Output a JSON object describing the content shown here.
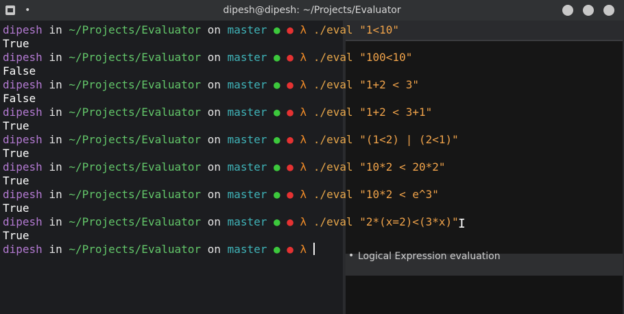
{
  "window": {
    "title": "dipesh@dipesh: ~/Projects/Evaluator",
    "menu_dot": "•"
  },
  "prompt": {
    "user": "dipesh",
    "in": "in",
    "path": "~/Projects/Evaluator",
    "on": "on",
    "branch": "master",
    "dot_green": "●",
    "dot_red": "●",
    "lambda": "λ"
  },
  "commands": [
    {
      "cmd": "./eval",
      "arg": "\"1<10\"",
      "output": "True"
    },
    {
      "cmd": "./eval",
      "arg": "\"100<10\"",
      "output": "False"
    },
    {
      "cmd": "./eval",
      "arg": "\"1+2 < 3\"",
      "output": "False"
    },
    {
      "cmd": "./eval",
      "arg": "\"1+2 < 3+1\"",
      "output": "True"
    },
    {
      "cmd": "./eval",
      "arg": "\"(1<2) | (2<1)\"",
      "output": "True"
    },
    {
      "cmd": "./eval",
      "arg": "\"10*2 < 20*2\"",
      "output": "True"
    },
    {
      "cmd": "./eval",
      "arg": "\"10*2 < e^3\"",
      "output": "True"
    },
    {
      "cmd": "./eval",
      "arg": "\"2*(x=2)<(3*x)\"",
      "output": "True"
    }
  ],
  "background": {
    "bullet_text": "Logical Expression evaluation"
  }
}
